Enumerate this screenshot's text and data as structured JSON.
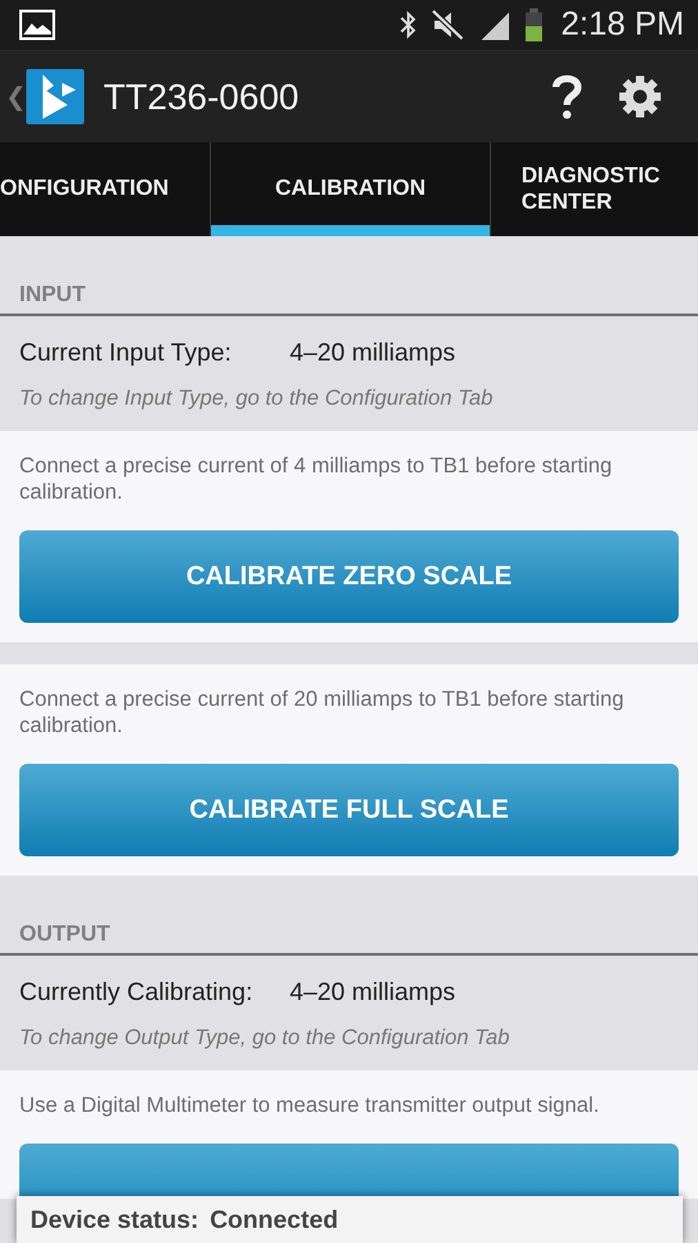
{
  "status_bar": {
    "time": "2:18 PM"
  },
  "action_bar": {
    "title": "TT236-0600",
    "back": "❮"
  },
  "tabs": [
    {
      "label": "ONFIGURATION",
      "selected": false
    },
    {
      "label": "CALIBRATION",
      "selected": true
    },
    {
      "label": "DIAGNOSTIC CENTER",
      "selected": false
    }
  ],
  "sections": [
    {
      "header": "INPUT",
      "info": {
        "label": "Current Input Type:",
        "value": "4–20 milliamps",
        "hint": "To change Input Type, go to the Configuration Tab"
      },
      "steps": [
        {
          "kind": "full",
          "instruction": "Connect a precise current of 4 milliamps to TB1 before starting calibration.",
          "button": "CALIBRATE ZERO SCALE"
        },
        {
          "kind": "full",
          "instruction": "Connect a precise current of 20 milliamps to TB1 before starting calibration.",
          "button": "CALIBRATE FULL SCALE"
        }
      ]
    },
    {
      "header": "OUTPUT",
      "info": {
        "label": "Currently Calibrating:",
        "value": "4–20 milliamps",
        "hint": "To change Output Type, go to the Configuration Tab"
      },
      "steps": [
        {
          "kind": "cut",
          "instruction": "Use a Digital Multimeter to measure transmitter output signal."
        }
      ]
    }
  ],
  "device_status": {
    "label": "Device status:",
    "value": "Connected"
  }
}
